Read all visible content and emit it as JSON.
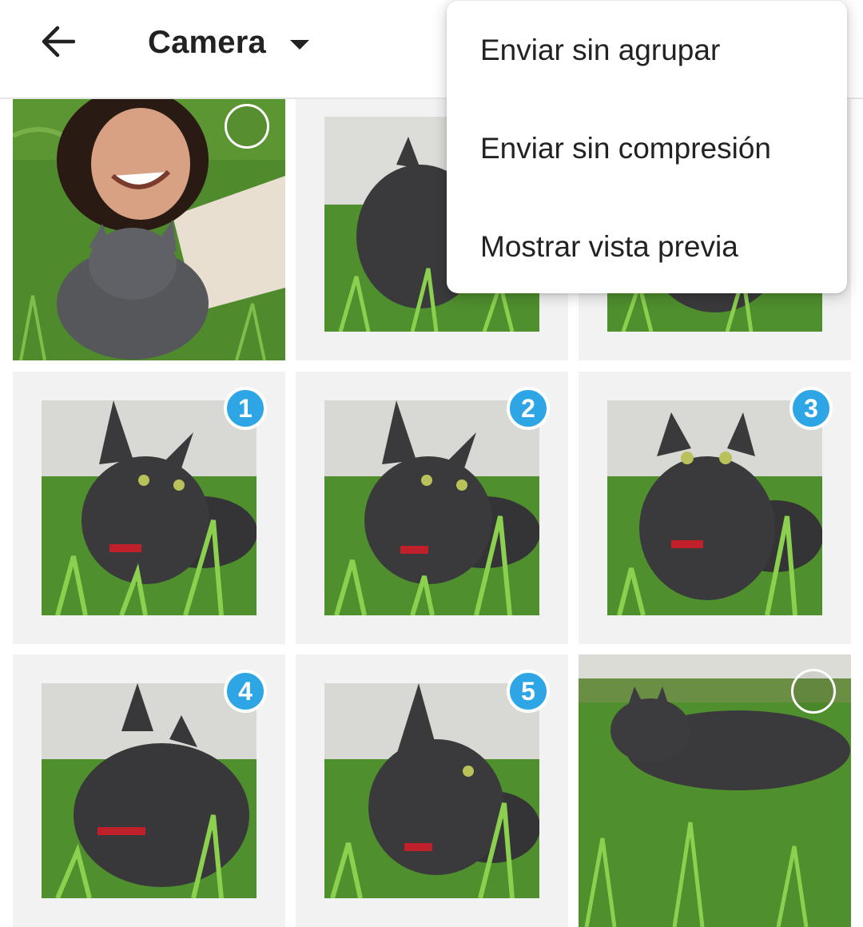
{
  "header": {
    "back_icon": "arrow-left-icon",
    "album_title": "Camera",
    "dropdown_icon": "caret-down-icon"
  },
  "menu": {
    "items": [
      {
        "label": "Enviar sin agrupar"
      },
      {
        "label": "Enviar sin compresión"
      },
      {
        "label": "Mostrar vista previa"
      }
    ]
  },
  "grid": {
    "cells": [
      {
        "subject": "woman-and-cat-photo",
        "selected": false,
        "order": ""
      },
      {
        "subject": "cat-in-grass-photo",
        "selected": false,
        "order": ""
      },
      {
        "subject": "cat-in-grass-photo",
        "selected": false,
        "order": ""
      },
      {
        "subject": "cat-in-grass-photo",
        "selected": true,
        "order": "1"
      },
      {
        "subject": "cat-in-grass-photo",
        "selected": true,
        "order": "2"
      },
      {
        "subject": "cat-in-grass-photo",
        "selected": true,
        "order": "3"
      },
      {
        "subject": "cat-in-grass-photo",
        "selected": true,
        "order": "4"
      },
      {
        "subject": "cat-in-grass-photo",
        "selected": true,
        "order": "5"
      },
      {
        "subject": "cat-lying-in-grass-photo",
        "selected": false,
        "order": ""
      }
    ]
  },
  "colors": {
    "selection_badge": "#2ea6e6",
    "cell_background": "#f2f2f2",
    "grass": "#4f8f2e",
    "cat": "#3a3a3c"
  }
}
